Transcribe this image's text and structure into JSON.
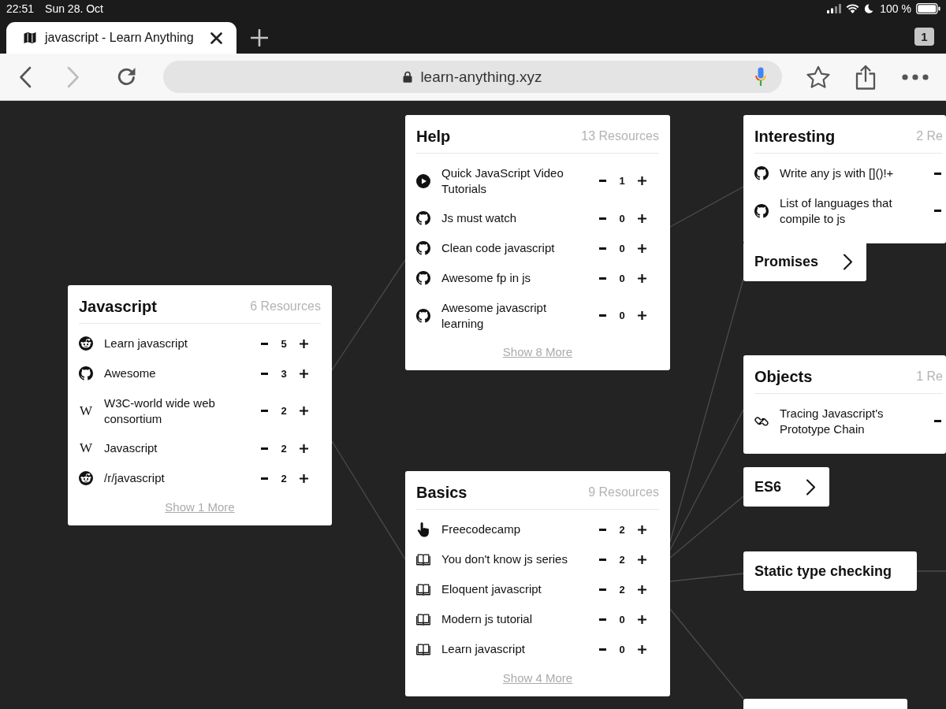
{
  "status_bar": {
    "time": "22:51",
    "date": "Sun 28. Oct",
    "battery": "100 %"
  },
  "tab_bar": {
    "tabs": [
      {
        "title": "javascript - Learn Anything",
        "selected": true
      }
    ],
    "tab_count": "1"
  },
  "toolbar": {
    "back": {
      "disabled": false
    },
    "forward": {
      "disabled": true
    },
    "url": "learn-anything.xyz"
  },
  "map": {
    "nodes": [
      {
        "kind": "card",
        "title": "Javascript",
        "count": "6 Resources",
        "clipped": false,
        "resources": [
          {
            "kind": "forum",
            "title": "Learn javascript",
            "votes": "5"
          },
          {
            "kind": "repo",
            "title": "Awesome",
            "votes": "3"
          },
          {
            "kind": "wiki",
            "letter": "W",
            "title": "W3C-world wide web consortium",
            "votes": "2"
          },
          {
            "kind": "wiki",
            "letter": "W",
            "title": "Javascript",
            "votes": "2"
          },
          {
            "kind": "forum",
            "title": "/r/javascript",
            "votes": "2"
          }
        ],
        "more": "Show 1 More"
      },
      {
        "kind": "card",
        "title": "Help",
        "count": "13 Resources",
        "clipped": false,
        "resources": [
          {
            "kind": "video",
            "title": "Quick JavaScript Video Tutorials",
            "votes": "1"
          },
          {
            "kind": "repo",
            "title": "Js must watch",
            "votes": "0"
          },
          {
            "kind": "repo",
            "title": "Clean code javascript",
            "votes": "0"
          },
          {
            "kind": "repo",
            "title": "Awesome fp in js",
            "votes": "0"
          },
          {
            "kind": "repo",
            "title": "Awesome javascript learning",
            "votes": "0"
          }
        ],
        "more": "Show 8 More"
      },
      {
        "kind": "card",
        "title": "Basics",
        "count": "9 Resources",
        "clipped": false,
        "resources": [
          {
            "kind": "course",
            "title": "Freecodecamp",
            "votes": "2"
          },
          {
            "kind": "book",
            "title": "You don't know js series",
            "votes": "2"
          },
          {
            "kind": "book",
            "title": "Eloquent javascript",
            "votes": "2"
          },
          {
            "kind": "book",
            "title": "Modern js tutorial",
            "votes": "0"
          },
          {
            "kind": "book",
            "title": "Learn javascript",
            "votes": "0"
          }
        ],
        "more": "Show 4 More"
      },
      {
        "kind": "card",
        "title": "Interesting",
        "count": "2 Re",
        "clipped": true,
        "resources": [
          {
            "kind": "repo",
            "title": "Write any js with []()!+"
          },
          {
            "kind": "repo",
            "title": "List of languages that compile to js"
          }
        ]
      },
      {
        "kind": "topic",
        "title": "Promises",
        "expandable": true
      },
      {
        "kind": "card",
        "title": "Objects",
        "count": "1 Re",
        "clipped": true,
        "resources": [
          {
            "kind": "article",
            "title": "Tracing Javascript's Prototype Chain"
          }
        ]
      },
      {
        "kind": "topic",
        "title": "ES6",
        "expandable": true
      },
      {
        "kind": "topic",
        "title": "Static type checking",
        "expandable": false
      },
      {
        "kind": "stub"
      }
    ]
  }
}
